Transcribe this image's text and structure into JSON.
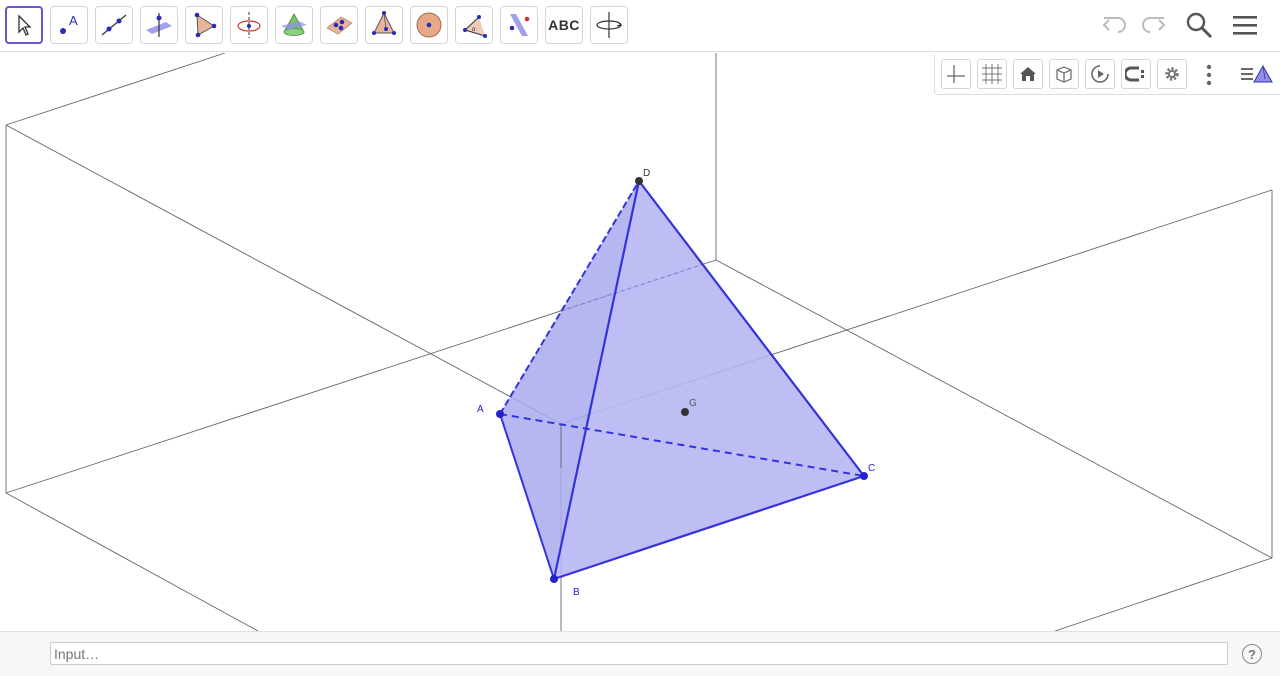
{
  "toolbar": {
    "tools": [
      {
        "name": "move-tool",
        "icon": "move-arrow-icon"
      },
      {
        "name": "point-tool",
        "icon": "point-icon",
        "glyph": "A"
      },
      {
        "name": "line-tool",
        "icon": "line-through-two-points-icon"
      },
      {
        "name": "perpendicular-line-tool",
        "icon": "perpendicular-line-icon"
      },
      {
        "name": "polygon-tool",
        "icon": "triangle-icon"
      },
      {
        "name": "circle-axis-tool",
        "icon": "circle-around-axis-icon"
      },
      {
        "name": "intersect-surfaces-tool",
        "icon": "cone-icon"
      },
      {
        "name": "plane-tool",
        "icon": "plane-through-points-icon"
      },
      {
        "name": "pyramid-tool",
        "icon": "pyramid-icon"
      },
      {
        "name": "sphere-tool",
        "icon": "sphere-icon"
      },
      {
        "name": "angle-tool",
        "icon": "angle-icon"
      },
      {
        "name": "reflect-tool",
        "icon": "reflect-about-plane-icon"
      },
      {
        "name": "text-tool",
        "label": "ABC"
      },
      {
        "name": "rotate-view-tool",
        "icon": "rotate-3d-view-icon"
      }
    ],
    "undo_icon": "undo-icon",
    "redo_icon": "redo-icon",
    "search_icon": "search-icon",
    "menu_icon": "menu-icon"
  },
  "view_bar": {
    "items": [
      "axes-icon",
      "grid-icon",
      "home-icon",
      "cube-icon",
      "rotate-icon",
      "clipping-icon",
      "gear-icon",
      "more-vertical-icon",
      "graphics-style-icon"
    ]
  },
  "points": {
    "A": "A",
    "B": "B",
    "C": "C",
    "D": "D",
    "G": "G"
  },
  "colors": {
    "face": "#a7a7f0",
    "edge": "#3333dd",
    "point": "#2222cc",
    "point_dark": "#333333",
    "box": "#555555",
    "accent": "#6557d2"
  },
  "input_bar": {
    "placeholder": "Input…",
    "help_label": "?"
  }
}
